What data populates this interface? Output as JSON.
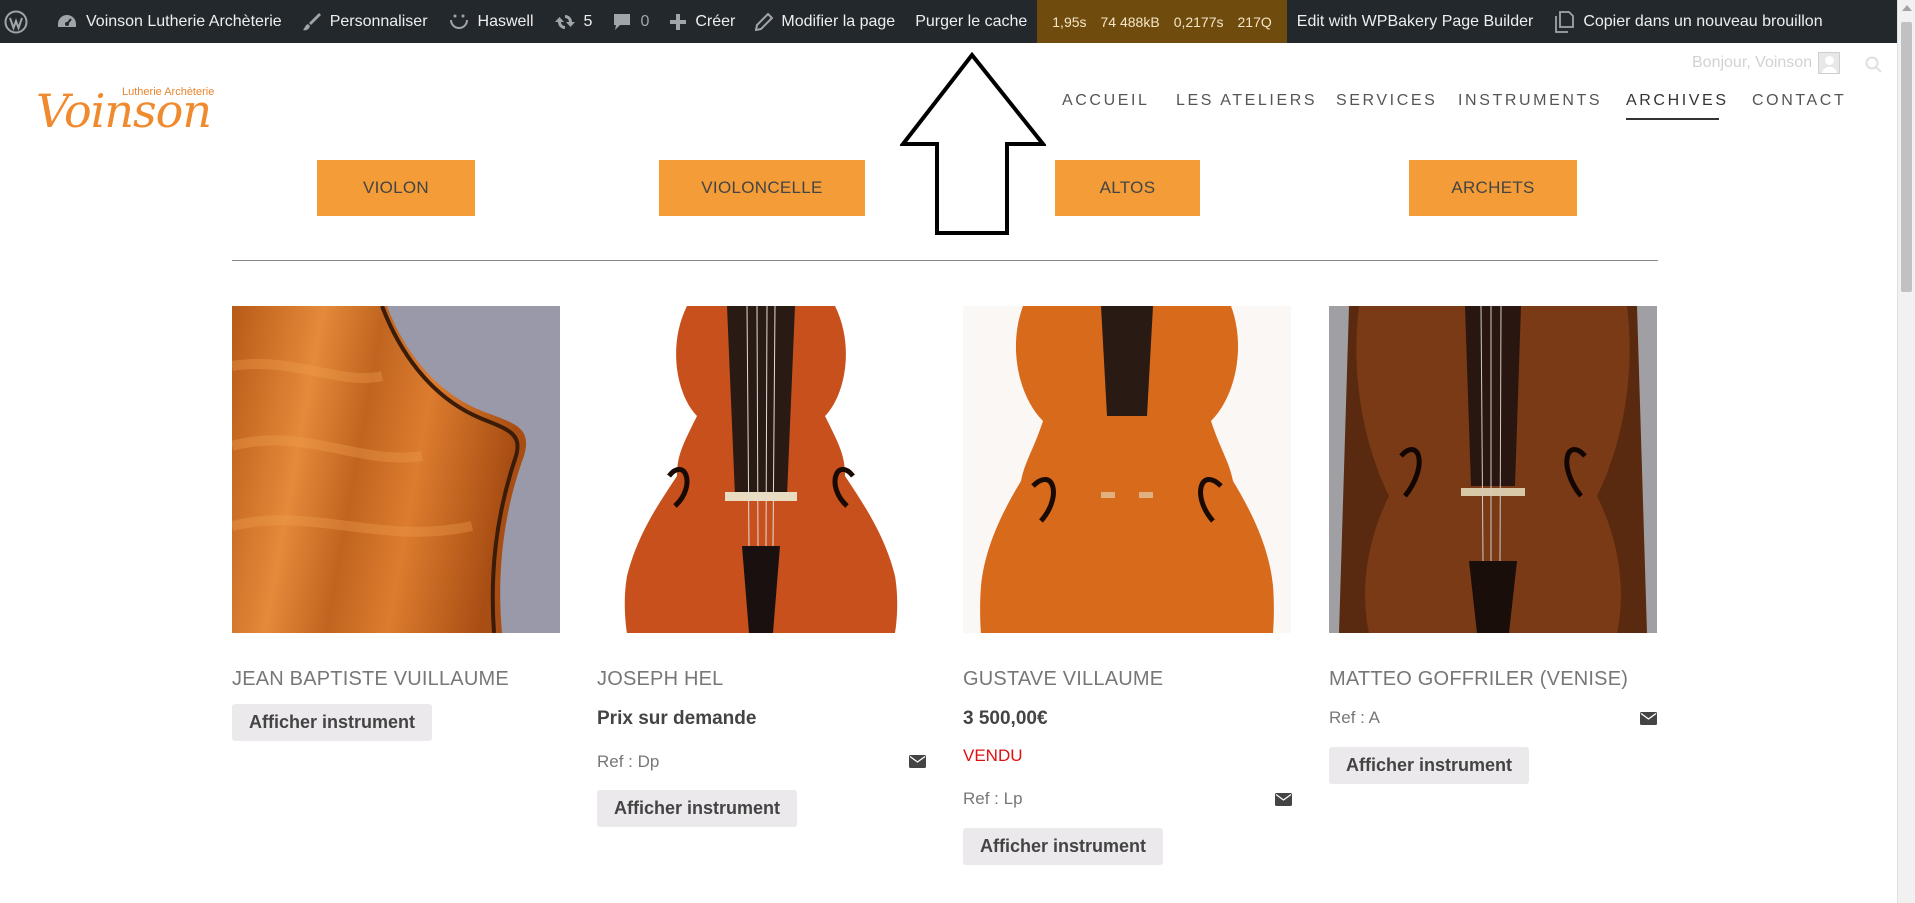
{
  "adminbar": {
    "site_name": "Voinson Lutherie Archèterie",
    "customize": "Personnaliser",
    "theme": "Haswell",
    "updates_count": "5",
    "comments_count": "0",
    "new_label": "Créer",
    "edit_page": "Modifier la page",
    "purge_cache": "Purger le cache",
    "perf": [
      "1,95s",
      "74 488kB",
      "0,2177s",
      "217Q"
    ],
    "wpbakery": "Edit with WPBakery Page Builder",
    "copy_draft": "Copier dans un nouveau brouillon"
  },
  "header": {
    "greeting": "Bonjour, Voinson",
    "logo_main": "Voinson",
    "logo_small": "Lutherie Archèterie"
  },
  "nav": {
    "items": [
      "ACCUEIL",
      "LES ATELIERS",
      "SERVICES",
      "INSTRUMENTS",
      "ARCHIVES",
      "CONTACT"
    ],
    "active": "ARCHIVES"
  },
  "categories": [
    "VIOLON",
    "VIOLONCELLE",
    "ALTOS",
    "ARCHETS"
  ],
  "products": [
    {
      "title": "JEAN BAPTISTE VUILLAUME",
      "button": "Afficher instrument"
    },
    {
      "title": "JOSEPH HEL",
      "price": "Prix sur demande",
      "ref": "Ref : Dp",
      "button": "Afficher instrument"
    },
    {
      "title": "GUSTAVE VILLAUME",
      "price": "3 500,00€",
      "status": "VENDU",
      "ref": "Ref : Lp",
      "button": "Afficher instrument"
    },
    {
      "title": "MATTEO GOFFRILER (VENISE)",
      "ref": "Ref : A",
      "button": "Afficher instrument"
    }
  ],
  "colors": {
    "adminbar_bg": "#23282d",
    "accent_orange": "#f39c38",
    "sold_red": "#e01010",
    "perf_bg": "#6f4c0d"
  }
}
